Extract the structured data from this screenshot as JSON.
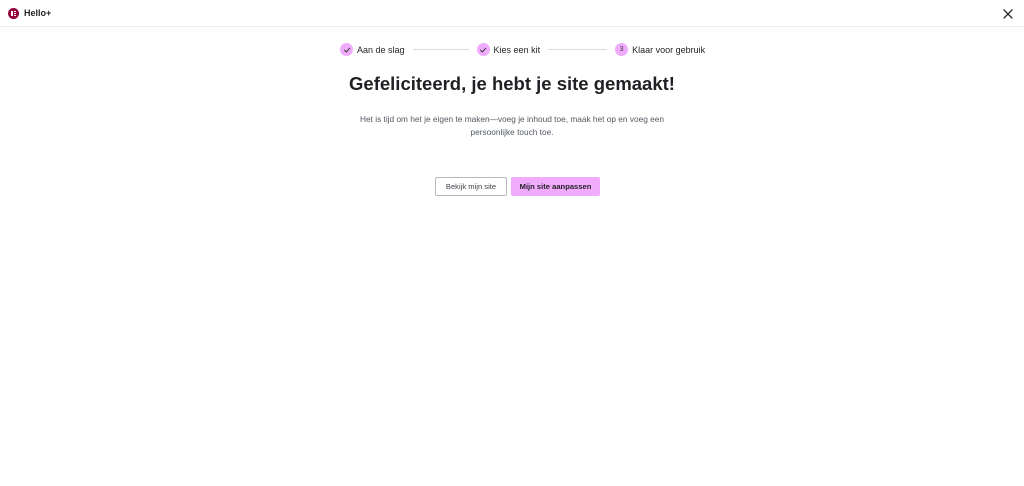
{
  "app": {
    "title": "Hello+"
  },
  "stepper": {
    "steps": [
      {
        "label": "Aan de slag",
        "status": "completed",
        "marker": ""
      },
      {
        "label": "Kies een kit",
        "status": "completed",
        "marker": ""
      },
      {
        "label": "Klaar voor gebruik",
        "status": "current",
        "marker": "3"
      }
    ]
  },
  "main": {
    "title": "Gefeliciteerd, je hebt je site gemaakt!",
    "subtitle": "Het is tijd om het je eigen te maken—voeg je inhoud toe, maak het op en voeg een persoonlijke touch toe."
  },
  "actions": {
    "view_site": "Bekijk mijn site",
    "customize_site": "Mijn site aanpassen"
  },
  "colors": {
    "accent": "#f0abfc",
    "brand": "#92003b",
    "text": "#1f2124"
  },
  "icons": {
    "logo": "elementor-logo-icon",
    "close": "close-icon",
    "check": "check-icon"
  }
}
